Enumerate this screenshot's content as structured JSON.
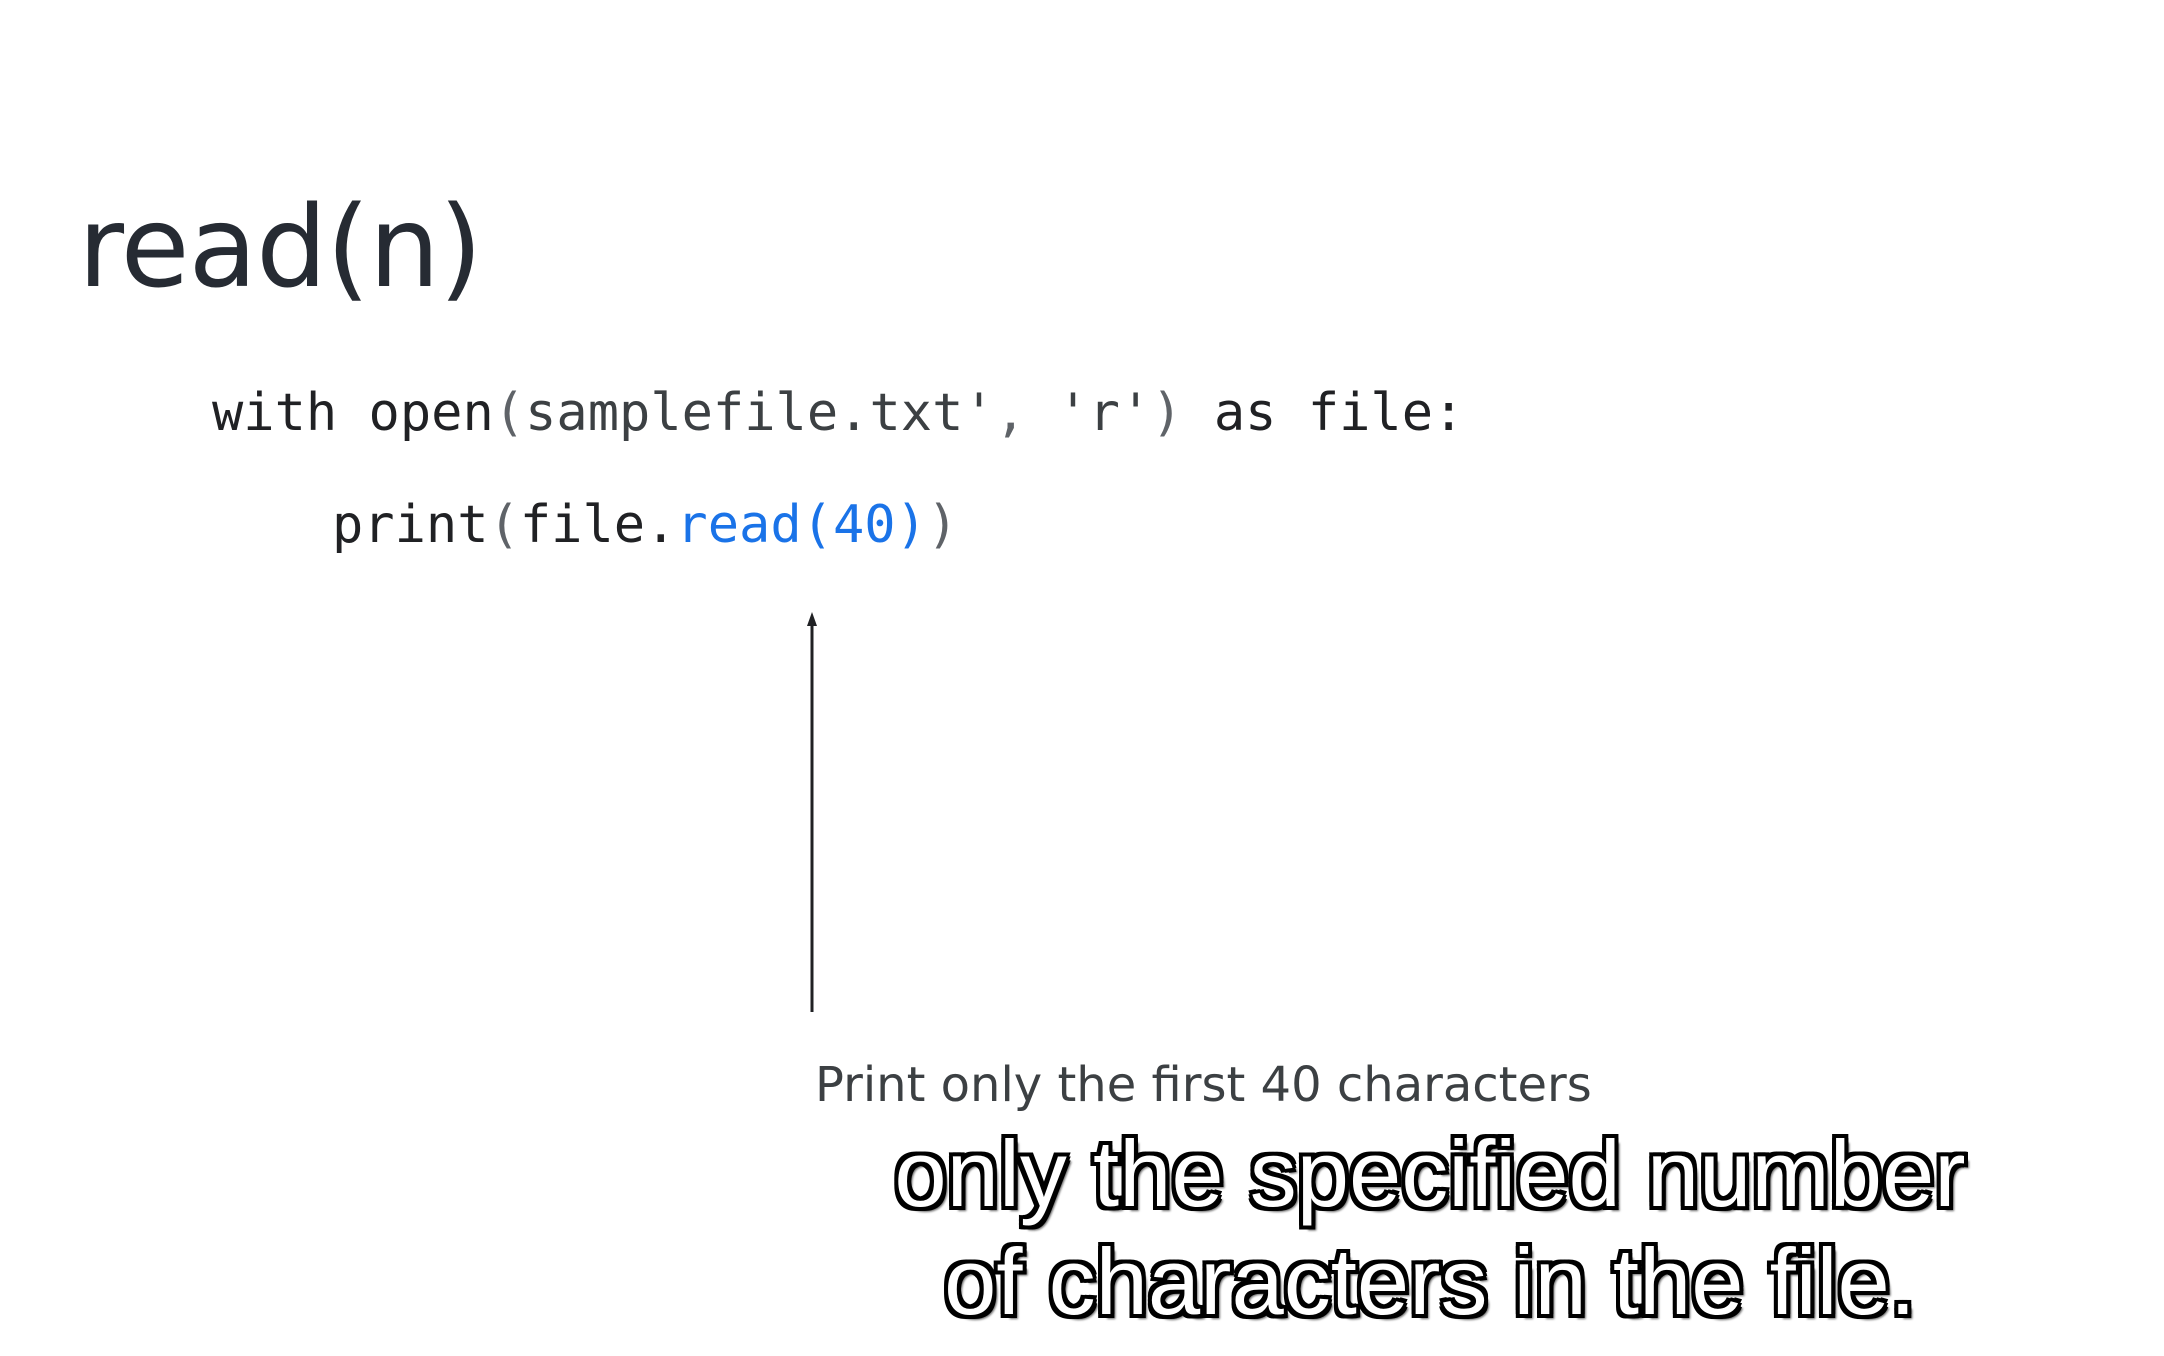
{
  "slide": {
    "title": "read(n)",
    "code": {
      "line1": {
        "kw_with": "with",
        "fn_open": "open",
        "paren_open": "(",
        "arg_file": "samplefile.txt'",
        "comma": ",",
        "arg_mode": "'r'",
        "paren_close": ")",
        "kw_as": "as",
        "var_file": "file:"
      },
      "line2": {
        "fn_print": "print",
        "paren_open": "(",
        "obj": "file.",
        "method": "read(40)",
        "paren_close": ")"
      }
    },
    "arrow_icon": "up-arrow-icon",
    "caption": "Print only the first 40 characters"
  },
  "subtitles": {
    "line1": "only the specified number",
    "line2": "of characters in the file."
  },
  "colors": {
    "background": "#ffffff",
    "title": "#262b33",
    "code": "#202124",
    "method_highlight": "#1a73e8",
    "subtitle_fill": "#ffffff",
    "subtitle_outline": "#000000"
  }
}
